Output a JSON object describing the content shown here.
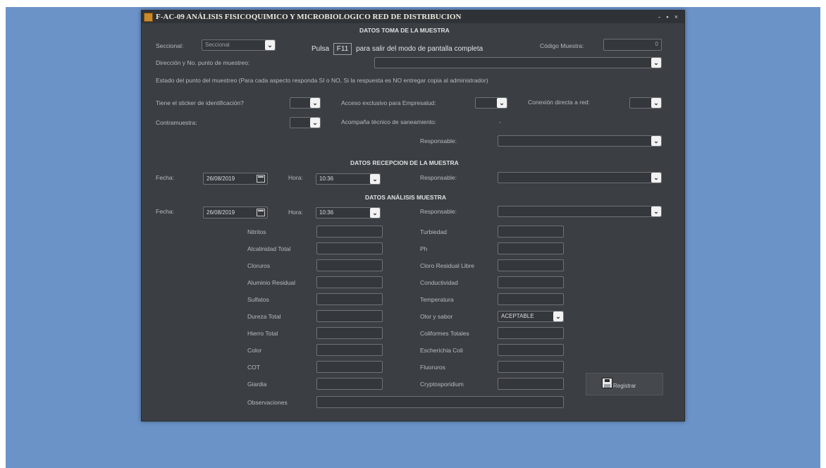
{
  "window": {
    "title": "F-AC-09 ANÁLISIS FISICOQUIMICO Y MICROBIOLOGICO RED DE DISTRIBUCION",
    "controls": "- ▪ ×"
  },
  "fullscreen_tip": {
    "prefix": "Pulsa",
    "key": "F11",
    "suffix": "para salir del modo de pantalla completa"
  },
  "toma": {
    "title": "DATOS TOMA DE LA MUESTRA",
    "sesional_label": "Seccional:",
    "sesional_value": "Seccional",
    "codigo_label": "Código Muestra:",
    "codigo_value": "0",
    "direccion_label": "Dirección y No. punto de muestreo:",
    "estado_text": "Estado del punto del muestreo (Para cada aspecto responda SI o NO, Si la respuesta es NO entregar copia al administrador)",
    "sticker_label": "Tiene el sticker de identificación?",
    "acceso_label": "Acceso exclusivo para Empresalud:",
    "conexion_label": "Conexión directa a red:",
    "contramuestra_label": "Contramuestra:",
    "acompana_label": "Acompaña técnico de saneamiento:",
    "responsable_label": "Responsable:"
  },
  "recepcion": {
    "title": "DATOS RECEPCION DE LA MUESTRA",
    "fecha_label": "Fecha:",
    "fecha_value": "26/08/2019",
    "hora_label": "Hora:",
    "hora_value": "10:36",
    "responsable_label": "Responsable:"
  },
  "analisis": {
    "title": "DATOS ANÁLISIS MUESTRA",
    "fecha_label": "Fecha:",
    "fecha_value": "26/08/2019",
    "hora_label": "Hora:",
    "hora_value": "10:36",
    "responsable_label": "Responsable:",
    "left_fields": [
      "Nitritos",
      "Alcalinidad Total",
      "Cloruros",
      "Aluminio Residual",
      "Sulfatos",
      "Dureza Total",
      "Hierro Total",
      "Color",
      "COT",
      "Giardia"
    ],
    "right_fields": [
      "Turbiedad",
      "Ph",
      "Cloro Residual Libre",
      "Conductividad",
      "Temperatura",
      "Olor y sabor",
      "Coliformes Totales",
      "Escherichia Coli",
      "Fluoruros",
      "Cryptosporidium"
    ],
    "olor_value": "ACEPTABLE",
    "observaciones_label": "Observaciones",
    "save_label": "Registrar"
  },
  "icons": {
    "save": "floppy-disk-icon",
    "calendar": "calendar-icon",
    "dropdown": "chevron-down-icon"
  },
  "colors": {
    "window_bg": "#3b3e42",
    "desktop": "#6b93c8",
    "titlebar": "#2f3236"
  }
}
